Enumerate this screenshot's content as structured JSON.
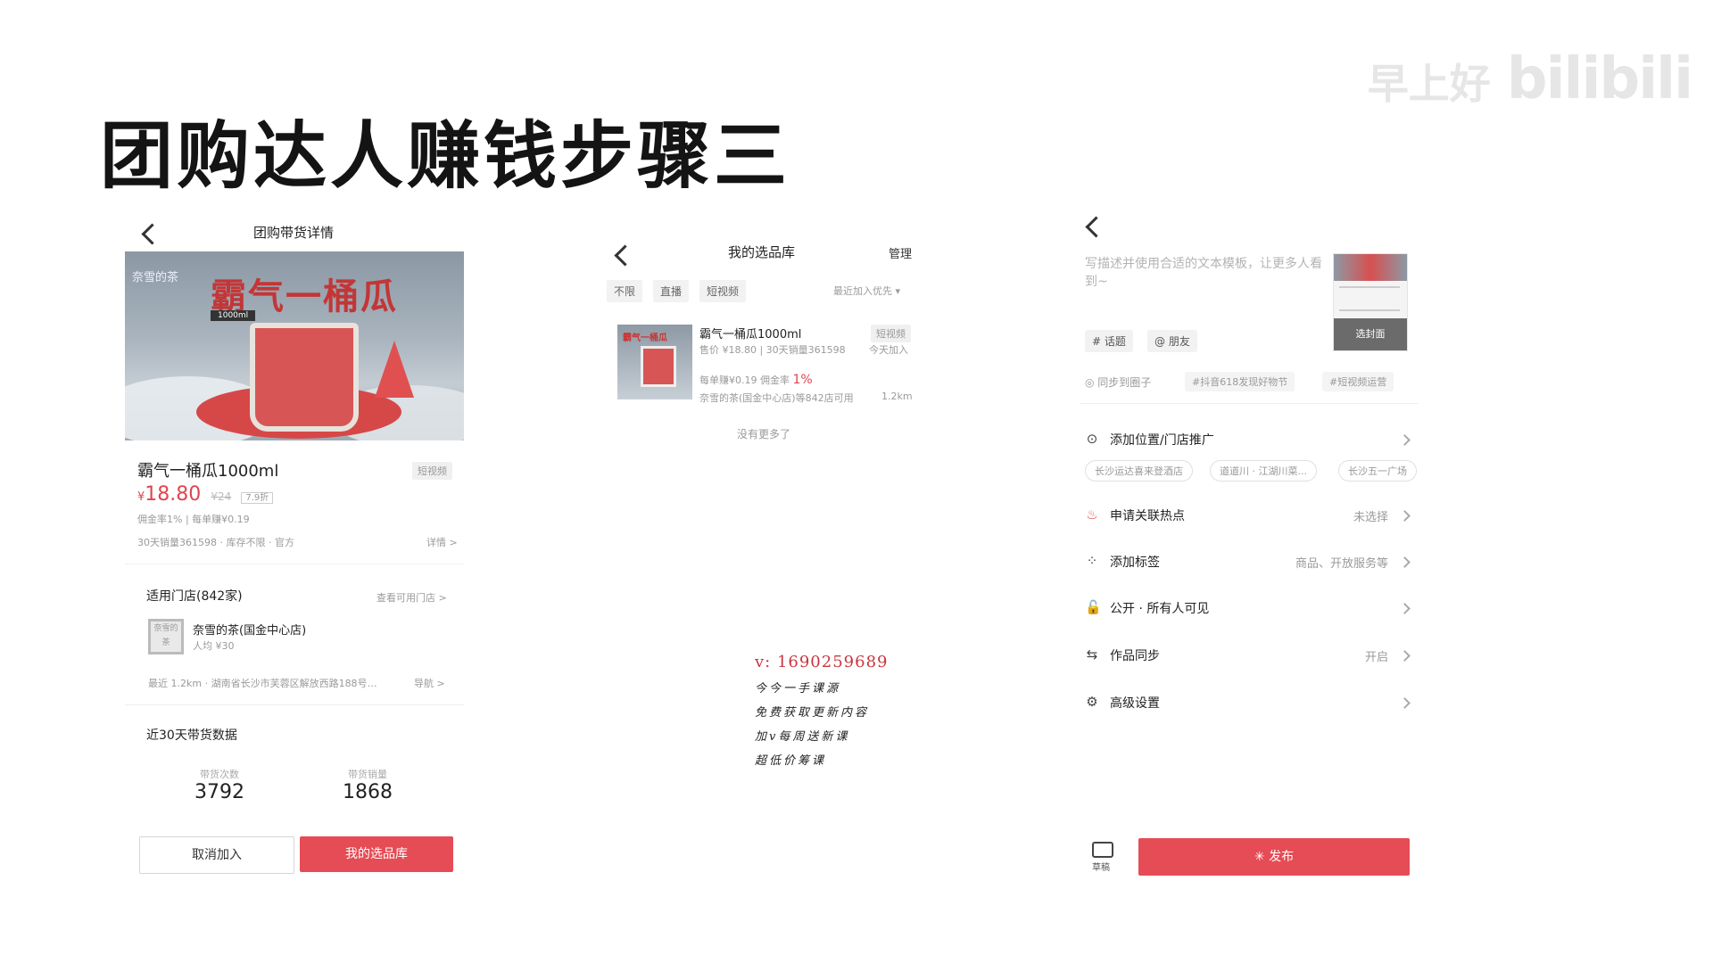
{
  "slide": {
    "title": "团购达人赚钱步骤三",
    "watermark": "早上好",
    "watermark_logo": "bilibili"
  },
  "panel1": {
    "header_title": "团购带货详情",
    "hero_title": "霸气一桶瓜",
    "hero_brand": "奈雪的茶",
    "hero_volume": "1000ml",
    "product_name": "霸气一桶瓜1000ml",
    "video_tag": "短视频",
    "price_symbol": "¥",
    "price": "18.80",
    "original_price": "¥24",
    "discount": "7.9折",
    "commission_line": "佣金率1% | 每单赚¥0.19",
    "sales_line": "30天销量361598 · 库存不限 · 官方",
    "details_link": "详情 >",
    "stores_title": "适用门店(842家)",
    "stores_link": "查看可用门店 >",
    "store_thumb": "奈雪的茶",
    "store_name": "奈雪的茶(国金中心店)",
    "store_avg": "人均 ¥30",
    "store_address": "最近 1.2km · 湖南省长沙市芙蓉区解放西路188号九...",
    "navigate": "导航 >",
    "data_title": "近30天带货数据",
    "stats": [
      {
        "label": "带货次数",
        "value": "3792"
      },
      {
        "label": "带货销量",
        "value": "1868"
      }
    ],
    "cancel_button": "取消加入",
    "library_button": "我的选品库"
  },
  "panel2": {
    "header_title": "我的选品库",
    "manage": "管理",
    "filters": [
      "不限",
      "直播",
      "短视频"
    ],
    "sort": "最近加入优先 ▾",
    "item": {
      "thumb_title": "霸气一桶瓜",
      "name": "霸气一桶瓜1000ml",
      "tag": "短视频",
      "price_line": "售价 ¥18.80 | 30天销量361598",
      "added": "今天加入",
      "earn_line": "每单赚¥0.19  佣金率",
      "commission": "1%",
      "store_line": "奈雪的茶(国金中心店)等842店可用",
      "distance": "1.2km"
    },
    "no_more": "没有更多了"
  },
  "promo": {
    "contact": "v: 1690259689",
    "lines": [
      "今今一手课源",
      "免费获取更新内容",
      "加v每周送新课",
      "超低价筹课"
    ]
  },
  "panel3": {
    "description_placeholder": "写描述并使用合适的文本模板，让更多人看到~",
    "cover_select": "选封面",
    "topic_button": "# 话题",
    "friend_button": "@ 朋友",
    "sync_label": "◎ 同步到圈子",
    "topic_chips": [
      "#抖音618发现好物节",
      "#短视频运营"
    ],
    "rows": [
      {
        "icon": "location-pin-icon",
        "glyph": "⊙",
        "label": "添加位置/门店推广",
        "value": ""
      },
      {
        "icon": "hot-topic-icon",
        "glyph": "♨",
        "label": "申请关联热点",
        "value": "未选择"
      },
      {
        "icon": "tag-grid-icon",
        "glyph": "⁘",
        "label": "添加标签",
        "value": "商品、开放服务等"
      },
      {
        "icon": "lock-icon",
        "glyph": "🔓",
        "label": "公开 · 所有人可见",
        "value": ""
      },
      {
        "icon": "sync-icon",
        "glyph": "⇆",
        "label": "作品同步",
        "value": "开启"
      },
      {
        "icon": "settings-icon",
        "glyph": "⚙",
        "label": "高级设置",
        "value": ""
      }
    ],
    "location_chips": [
      "长沙运达喜来登酒店",
      "道道川 · 江湖川菜...",
      "长沙五一广场"
    ],
    "draft_label": "草稿",
    "publish_button": "发布"
  },
  "colors": {
    "accent_red": "#e54c55",
    "gray_text": "#999999"
  }
}
